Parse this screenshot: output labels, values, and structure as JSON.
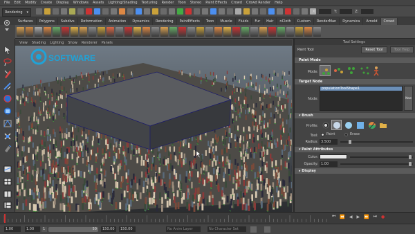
{
  "menubar": {
    "items": [
      "File",
      "Edit",
      "Modify",
      "Create",
      "Display",
      "Windows",
      "Assets",
      "Lighting/Shading",
      "Texturing",
      "Render",
      "Toon",
      "Stereo",
      "Paint Effects",
      "Crowd",
      "Crowd Render",
      "Help"
    ]
  },
  "statusline": {
    "menuset": "Rendering",
    "x_label": "X:",
    "y_label": "Y:",
    "z_label": "Z:"
  },
  "shelf": {
    "tabs": [
      "Surfaces",
      "Polygons",
      "Subdivs",
      "Deformation",
      "Animation",
      "Dynamics",
      "Rendering",
      "PaintEffects",
      "Toon",
      "Muscle",
      "Fluids",
      "Fur",
      "Hair",
      "nCloth",
      "Custom",
      "RenderMan",
      "Dynamica",
      "Arnold",
      "Crowd"
    ],
    "active_tab": "Crowd"
  },
  "viewport": {
    "menus": [
      "View",
      "Shading",
      "Lighting",
      "Show",
      "Renderer",
      "Panels"
    ],
    "watermark": "SOFTWARE"
  },
  "tool_settings": {
    "header_title": "Tool Settings",
    "tool_name": "Paint Tool",
    "reset_button": "Reset Tool",
    "help_button": "Tool Help",
    "paint_mode": {
      "section": "Paint Mode",
      "mode_label": "Mode:"
    },
    "target_node": {
      "section": "Target Node",
      "node_label": "Node:",
      "node_value": "populationToolShape1",
      "side_button": "New"
    },
    "brush": {
      "section": "Brush",
      "profile_label": "Profile:",
      "tool_label": "Tool:",
      "tool_options": [
        "Paint",
        "Erase"
      ],
      "tool_selected": "Paint",
      "radius_label": "Radius:",
      "radius_value": "3.500"
    },
    "paint_attributes": {
      "section": "Paint Attributes",
      "color_label": "Color:",
      "opacity_label": "Opacity:",
      "opacity_value": "1.00"
    },
    "display": {
      "section": "Display"
    }
  },
  "timeline": {
    "start_field": "1.00",
    "start_field_2": "1.00",
    "current_field": "1",
    "end_field": "50",
    "end_field_2": "150.00",
    "end_field_3": "150.00",
    "anim_layer": "No Anim Layer",
    "char_set": "No Character Set"
  },
  "colors": {
    "accent": "#8ab4d8",
    "crowd_green": "#3fa33a"
  }
}
